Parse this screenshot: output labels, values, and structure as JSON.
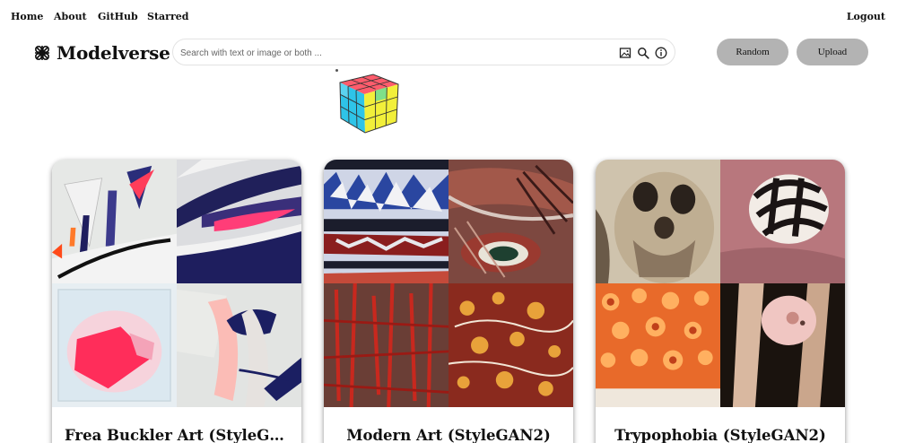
{
  "nav": {
    "home": "Home",
    "about": "About",
    "github": "GitHub",
    "starred": "Starred",
    "logout": "Logout"
  },
  "brand": {
    "name": "Modelverse",
    "logo_icon": "celtic-knot-icon"
  },
  "search": {
    "placeholder": "Search with text or image or both ...",
    "value": "",
    "icons": [
      "image-upload-icon",
      "search-icon",
      "info-icon"
    ]
  },
  "buttons": {
    "random": "Random",
    "upload": "Upload"
  },
  "query_image": {
    "icon": "rubiks-cube-icon"
  },
  "cards": [
    {
      "title": "Frea Buckler Art (StyleGA..."
    },
    {
      "title": "Modern Art (StyleGAN2)"
    },
    {
      "title": "Trypophobia (StyleGAN2)"
    }
  ],
  "colors": {
    "button_bg": "#b3b3b3",
    "search_border": "#e3e3e3",
    "text": "#111111"
  }
}
